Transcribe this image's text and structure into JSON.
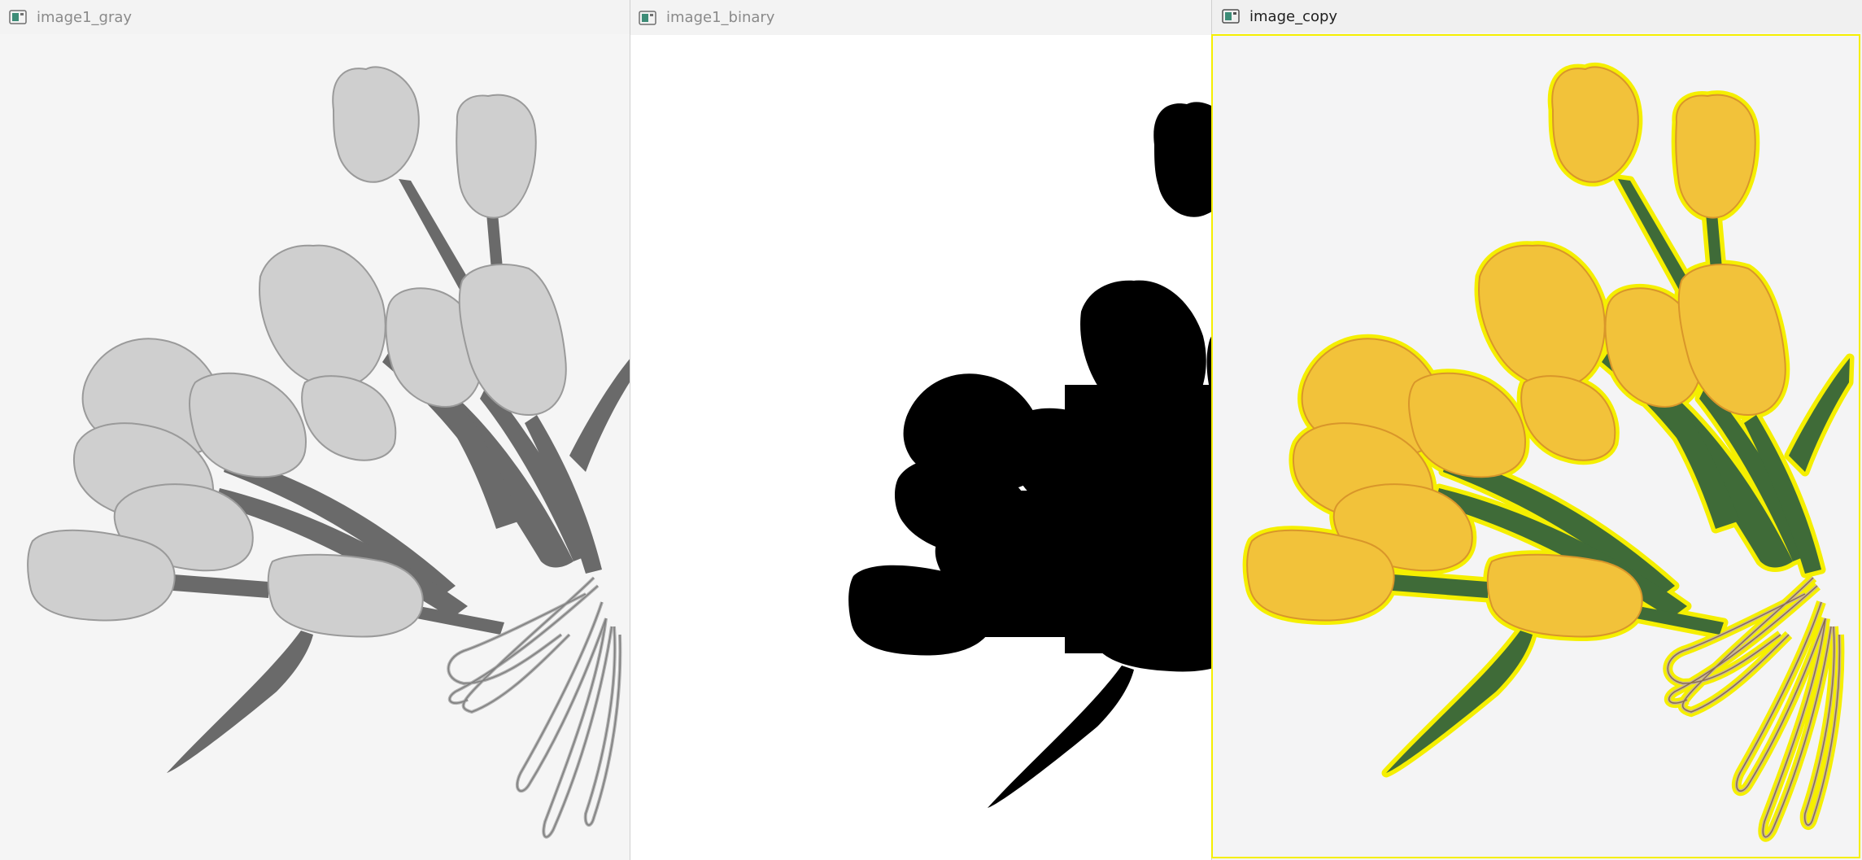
{
  "windows": [
    {
      "title": "image1_gray",
      "icon": "image-window-icon",
      "focused": false
    },
    {
      "title": "image1_binary",
      "icon": "image-window-icon",
      "focused": false
    },
    {
      "title": "image_copy",
      "icon": "image-window-icon",
      "focused": true
    }
  ],
  "colors": {
    "gray_background": "#f5f5f5",
    "binary_background": "#ffffff",
    "binary_foreground": "#000000",
    "copy_background": "#f4f4f5",
    "contour": "#f5ef00",
    "tulip_yellow": "#f2c23a",
    "leaf_green": "#3f6b38",
    "raffia": "#c8b49a"
  }
}
